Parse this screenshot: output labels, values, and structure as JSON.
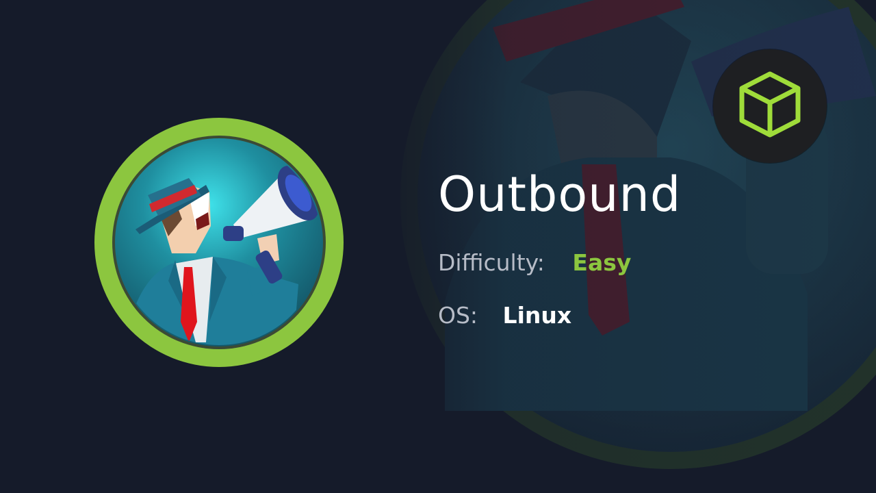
{
  "machine": {
    "name": "Outbound",
    "difficulty_label": "Difficulty:",
    "difficulty_value": "Easy",
    "os_label": "OS:",
    "os_value": "Linux"
  },
  "icons": {
    "badge_icon": "cube-icon",
    "avatar_art": "man-with-megaphone-avatar"
  },
  "colors": {
    "background": "#151b2a",
    "accent_green": "#8cc63f",
    "label_gray": "#b7bcc7",
    "title_white": "#ffffff"
  }
}
